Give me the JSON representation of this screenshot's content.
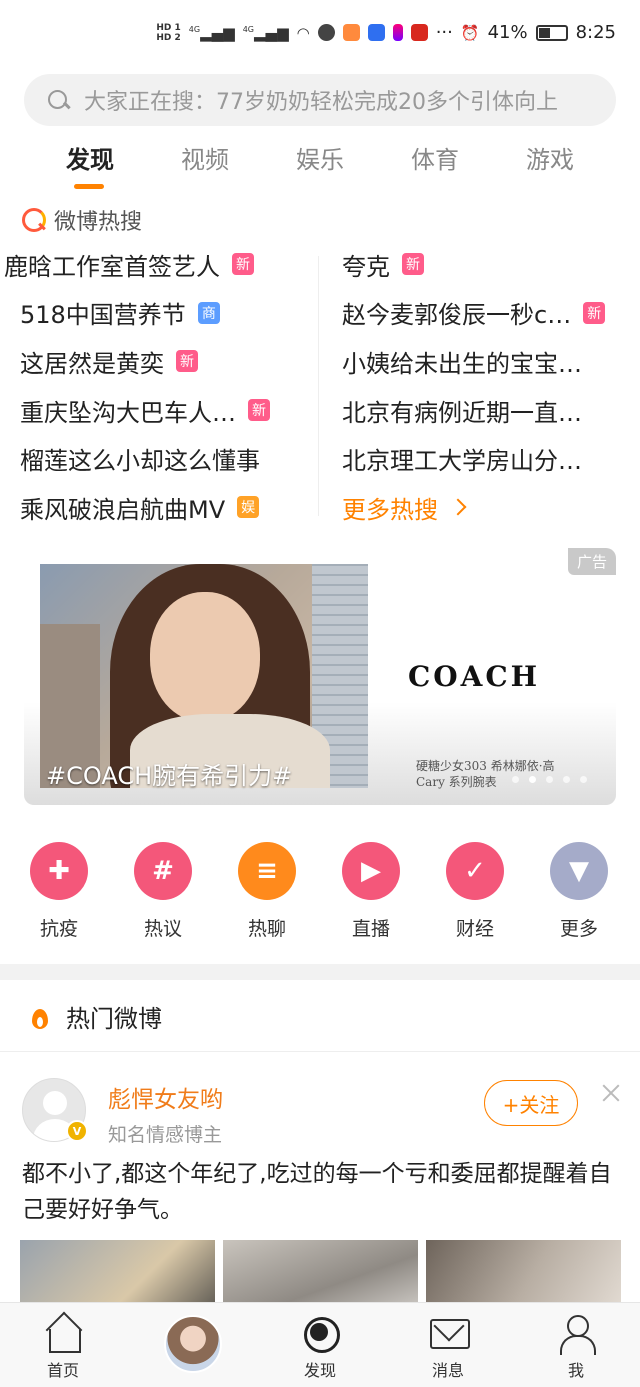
{
  "status_bar": {
    "hd1": "HD 1",
    "hd2": "HD 2",
    "network1": "4G",
    "network2": "4G",
    "battery": "41%",
    "time": "8:25",
    "overflow": "···"
  },
  "search": {
    "placeholder": "大家正在搜：77岁奶奶轻松完成20多个引体向上"
  },
  "tabs": [
    "发现",
    "视频",
    "娱乐",
    "体育",
    "游戏"
  ],
  "hot_search": {
    "title": "微博热搜",
    "left": [
      {
        "text": "鹿晗工作室首签艺人",
        "badge": "新",
        "badge_color": "#ff5c8a"
      },
      {
        "text": "518中国营养节",
        "badge": "商",
        "badge_color": "#5c9dff"
      },
      {
        "text": "这居然是黄奕",
        "badge": "新",
        "badge_color": "#ff5c8a"
      },
      {
        "text": "重庆坠沟大巴车人…",
        "badge": "新",
        "badge_color": "#ff5c8a"
      },
      {
        "text": "榴莲这么小却这么懂事",
        "badge": "",
        "badge_color": ""
      },
      {
        "text": "乘风破浪启航曲MV",
        "badge": "娱",
        "badge_color": "#ffa227"
      }
    ],
    "right": [
      {
        "text": "夸克",
        "badge": "新",
        "badge_color": "#ff5c8a"
      },
      {
        "text": "赵今麦郭俊辰一秒c…",
        "badge": "新",
        "badge_color": "#ff5c8a"
      },
      {
        "text": "小姨给未出生的宝宝…",
        "badge": "",
        "badge_color": ""
      },
      {
        "text": "北京有病例近期一直…",
        "badge": "",
        "badge_color": ""
      },
      {
        "text": "北京理工大学房山分…",
        "badge": "",
        "badge_color": ""
      }
    ],
    "more": "更多热搜"
  },
  "ad": {
    "label": "广告",
    "brand": "COACH",
    "caption": "#COACH腕有希引力#",
    "sub_line1": "硬糖少女303 希林娜依·高",
    "sub_line2": "Cary 系列腕表",
    "dots": 5,
    "active_dot": 1
  },
  "categories": [
    {
      "label": "抗疫",
      "icon": "heart-plus-icon",
      "glyph": "✚",
      "color": "#f4577a"
    },
    {
      "label": "热议",
      "icon": "hashtag-icon",
      "glyph": "#",
      "color": "#f4577a"
    },
    {
      "label": "热聊",
      "icon": "chat-bubble-icon",
      "glyph": "≡",
      "color": "#ff8a1c"
    },
    {
      "label": "直播",
      "icon": "tv-play-icon",
      "glyph": "▶",
      "color": "#f4577a"
    },
    {
      "label": "财经",
      "icon": "chart-check-icon",
      "glyph": "✓",
      "color": "#f4577a"
    },
    {
      "label": "更多",
      "icon": "triangle-down-icon",
      "glyph": "▼",
      "color": "#a5abc9"
    }
  ],
  "hot_weibo": {
    "title": "热门微博"
  },
  "post": {
    "name": "彪悍女友哟",
    "desc": "知名情感博主",
    "follow": "+关注",
    "text": "都不小了,都这个年纪了,吃过的每一个亏和委屈都提醒着自己要好好争气。"
  },
  "bottom_nav": [
    {
      "label": "首页",
      "icon": "home-icon"
    },
    {
      "label": "",
      "icon": "avatar"
    },
    {
      "label": "发现",
      "icon": "discover-icon"
    },
    {
      "label": "消息",
      "icon": "message-icon"
    },
    {
      "label": "我",
      "icon": "profile-icon"
    }
  ],
  "colors": {
    "accent": "#ff8200",
    "brand_orange": "#f07c1a"
  }
}
